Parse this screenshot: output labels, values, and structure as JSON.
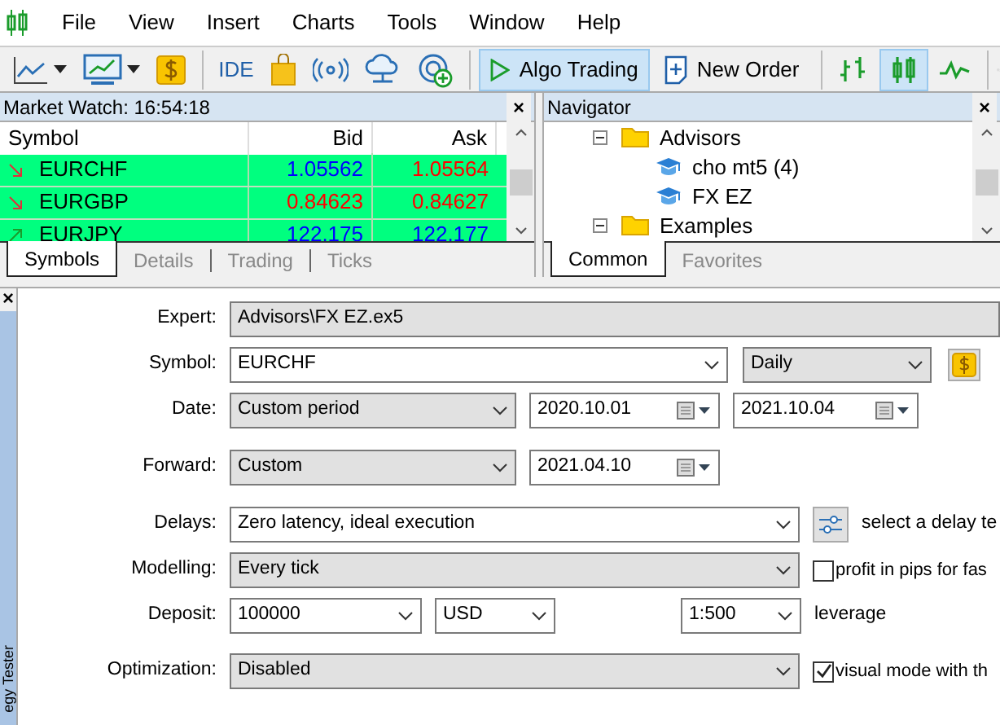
{
  "menu": [
    "File",
    "View",
    "Insert",
    "Charts",
    "Tools",
    "Window",
    "Help"
  ],
  "toolbar": {
    "ide": "IDE",
    "buttons": [
      {
        "label": "Algo Trading",
        "selected": true
      },
      {
        "label": "New Order",
        "selected": false
      }
    ],
    "chart_types": [
      {
        "selected": false
      },
      {
        "selected": true
      },
      {
        "selected": false
      }
    ]
  },
  "market_watch": {
    "title": "Market Watch: 16:54:18",
    "close": "×",
    "columns": [
      "Symbol",
      "Bid",
      "Ask"
    ],
    "rows": [
      {
        "symbol": "EURCHF",
        "rising": false,
        "bid": "1.05562",
        "bid_rising": true,
        "ask": "1.05564",
        "ask_rising": false
      },
      {
        "symbol": "EURGBP",
        "rising": false,
        "bid": "0.84623",
        "bid_rising": false,
        "ask": "0.84627",
        "ask_rising": false
      },
      {
        "symbol": "EURJPY",
        "rising": true,
        "bid": "122.175",
        "bid_rising": true,
        "ask": "122.177",
        "ask_rising": true
      }
    ],
    "tabs": [
      {
        "label": "Symbols",
        "selected": true
      },
      {
        "label": "Details",
        "selected": false
      },
      {
        "label": "Trading",
        "selected": false
      },
      {
        "label": "Ticks",
        "selected": false
      }
    ]
  },
  "navigator": {
    "title": "Navigator",
    "close": "×",
    "tree": [
      {
        "label": "Advisors",
        "expanded": true,
        "children": [
          {
            "label": "cho mt5 (4)"
          },
          {
            "label": "FX EZ"
          }
        ]
      },
      {
        "label": "Examples",
        "expanded": true
      }
    ],
    "tabs": [
      {
        "label": "Common",
        "selected": true
      },
      {
        "label": "Favorites",
        "selected": false
      }
    ]
  },
  "tester": {
    "close": "×",
    "side_tab": "egy Tester",
    "expert": {
      "label": "Expert:",
      "value": "Advisors\\FX EZ.ex5"
    },
    "symbol": {
      "label": "Symbol:",
      "value": "EURCHF",
      "period": "Daily"
    },
    "date": {
      "label": "Date:",
      "value": "Custom period",
      "from": "2020.10.01",
      "to": "2021.10.04"
    },
    "forward": {
      "label": "Forward:",
      "value": "Custom",
      "date": "2021.04.10"
    },
    "delays": {
      "label": "Delays:",
      "value": "Zero latency, ideal execution",
      "note": "select a delay te"
    },
    "modelling": {
      "label": "Modelling:",
      "value": "Every tick",
      "option": "profit in pips for fas",
      "checked": false
    },
    "deposit": {
      "label": "Deposit:",
      "value": "100000",
      "currency": "USD",
      "leverage": "1:500",
      "leverage_label": "leverage"
    },
    "optimization": {
      "label": "Optimization:",
      "value": "Disabled",
      "option": "visual mode with th",
      "checked": true
    }
  }
}
